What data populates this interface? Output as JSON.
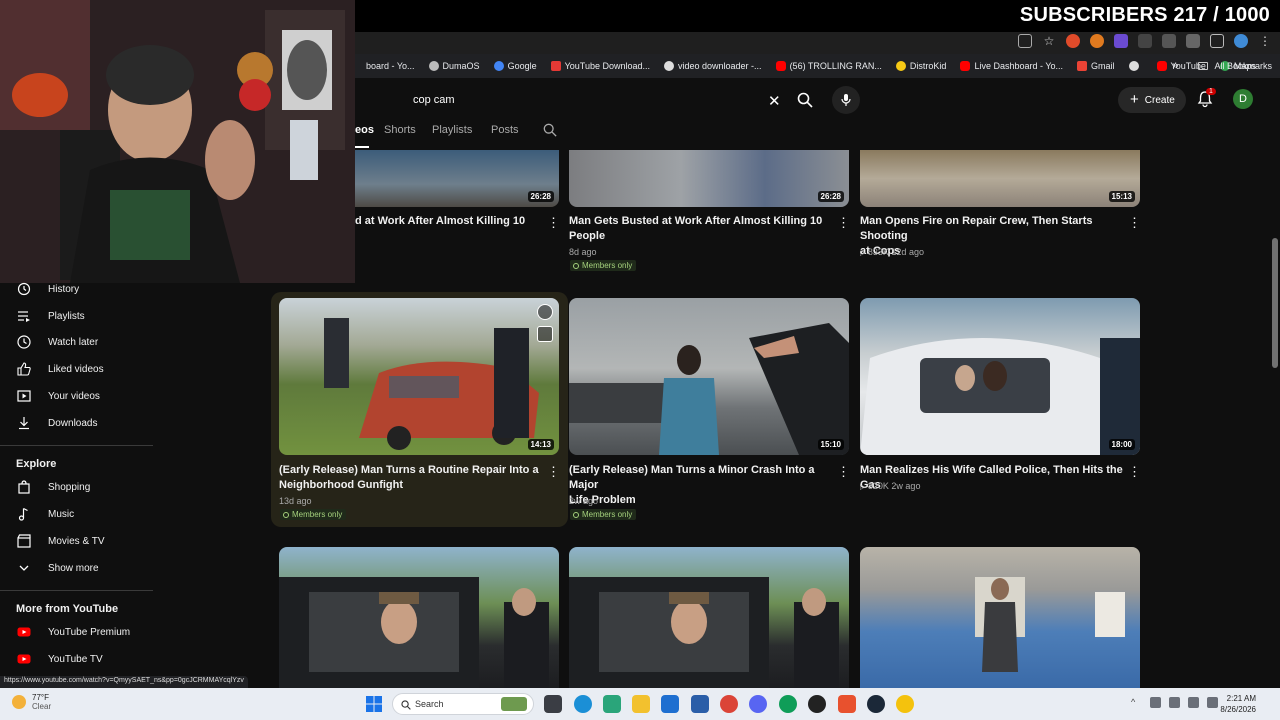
{
  "overlay": {
    "subscribers_text": "SUBSCRIBERS 217 / 1000"
  },
  "bookmarks": {
    "items": [
      {
        "label": "board - Yo...",
        "color": "#555555"
      },
      {
        "label": "DumaOS",
        "color": "#bbbbbb"
      },
      {
        "label": "Google",
        "color": "#4285f4"
      },
      {
        "label": "YouTube Download...",
        "color": "#e53935"
      },
      {
        "label": "video downloader -...",
        "color": "#dddddd"
      },
      {
        "label": "(56) TROLLING RAN...",
        "color": "#ff0000"
      },
      {
        "label": "DistroKid",
        "color": "#f6c915"
      },
      {
        "label": "Live Dashboard - Yo...",
        "color": "#ff0000"
      },
      {
        "label": "Gmail",
        "color": "#ea4335"
      },
      {
        "label": "",
        "color": "#dddddd"
      },
      {
        "label": "YouTube",
        "color": "#ff0000"
      },
      {
        "label": "Maps",
        "color": "#34a853"
      }
    ],
    "overflow": "»",
    "all_bookmarks": "All Bookmarks"
  },
  "header": {
    "search_value": "cop cam",
    "create_label": "Create",
    "notification_count": "1",
    "avatar_letter": "D"
  },
  "channel_tabs": {
    "videos_fragment": "eos",
    "shorts": "Shorts",
    "playlists": "Playlists",
    "posts": "Posts"
  },
  "sidebar": {
    "items": [
      {
        "label": "History",
        "icon": "history-icon"
      },
      {
        "label": "Playlists",
        "icon": "playlists-icon"
      },
      {
        "label": "Watch later",
        "icon": "watch-later-icon"
      },
      {
        "label": "Liked videos",
        "icon": "thumb-up-icon"
      },
      {
        "label": "Your videos",
        "icon": "your-videos-icon"
      },
      {
        "label": "Downloads",
        "icon": "download-icon"
      }
    ],
    "explore_heading": "Explore",
    "explore_items": [
      {
        "label": "Shopping",
        "icon": "shopping-bag-icon"
      },
      {
        "label": "Music",
        "icon": "music-note-icon"
      },
      {
        "label": "Movies & TV",
        "icon": "clapperboard-icon"
      },
      {
        "label": "Show more",
        "icon": "chevron-down-icon"
      }
    ],
    "more_heading": "More from YouTube",
    "more_items": [
      {
        "label": "YouTube Premium",
        "icon": "youtube-logo-icon"
      },
      {
        "label": "YouTube TV",
        "icon": "youtube-logo-icon"
      }
    ]
  },
  "videos": {
    "row1": [
      {
        "title_line1": "d at Work After Almost Killing 10",
        "title_line2": "",
        "meta": "",
        "members": "",
        "duration": "26:28"
      },
      {
        "title_line1": "Man Gets Busted at Work After Almost Killing 10",
        "title_line2": "People",
        "meta": "8d ago",
        "members": "Members only",
        "duration": "26:28"
      },
      {
        "title_line1": "Man Opens Fire on Repair Crew, Then Starts Shooting",
        "title_line2": "at Cops",
        "meta": "833K  12d ago",
        "members": "",
        "duration": "15:13"
      }
    ],
    "row2": [
      {
        "title_line1": "(Early Release) Man Turns a Routine Repair Into a",
        "title_line2": "Neighborhood Gunfight",
        "meta": "13d ago",
        "members": "Members only",
        "duration": "14:13"
      },
      {
        "title_line1": "(Early Release) Man Turns a Minor Crash Into a Major",
        "title_line2": "Life Problem",
        "meta": "2w ago",
        "members": "Members only",
        "duration": "15:10"
      },
      {
        "title_line1": "Man Realizes His Wife Called Police, Then Hits the Gas",
        "title_line2": "",
        "meta": "820K  2w ago",
        "members": "",
        "duration": "18:00"
      }
    ]
  },
  "status_url": "https://www.youtube.com/watch?v=QmyySAET_ns&pp=0gcJCRMMAYcqlYzv",
  "taskbar": {
    "weather_temp": "77°F",
    "weather_desc": "Clear",
    "search_placeholder": "Search",
    "time": "2:21 AM",
    "date": "8/26/2026"
  }
}
